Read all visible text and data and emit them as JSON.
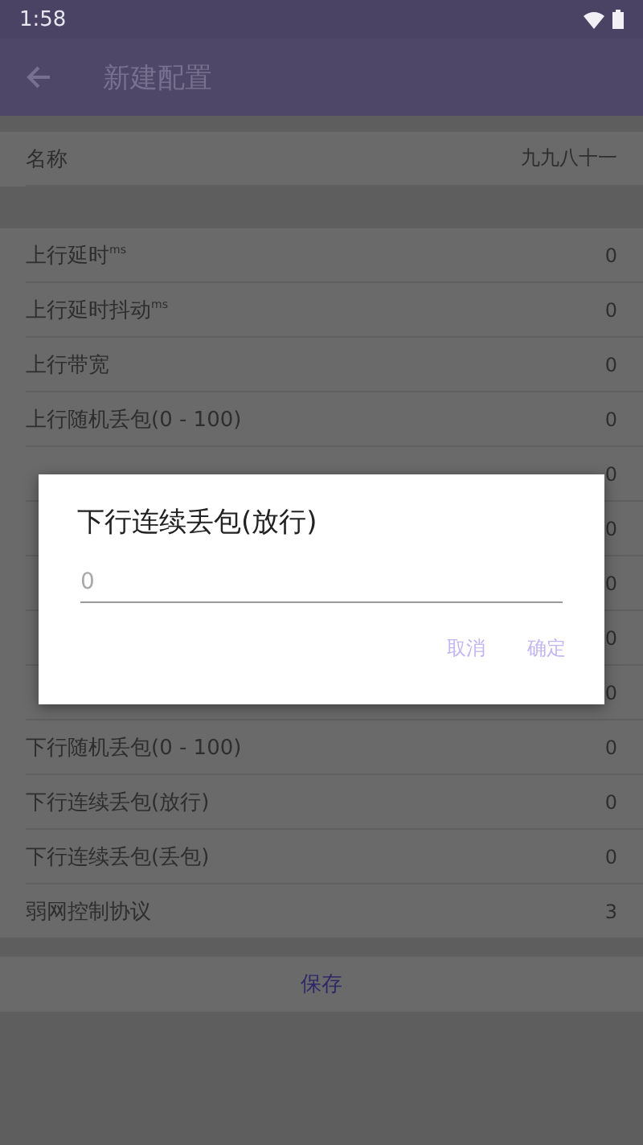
{
  "status_bar": {
    "time": "1:58"
  },
  "toolbar": {
    "title": "新建配置"
  },
  "name_row": {
    "label": "名称",
    "value": "九九八十一"
  },
  "rows": [
    {
      "label": "上行延时$^{ms}$",
      "value": "0"
    },
    {
      "label": "上行延时抖动$^{ms}$",
      "value": "0"
    },
    {
      "label": "上行带宽",
      "value": "0"
    },
    {
      "label": "上行随机丢包(0 - 100)",
      "value": "0"
    },
    {
      "value": "0"
    },
    {
      "value": "0"
    },
    {
      "value": "0"
    },
    {
      "value": "0"
    },
    {
      "value": "0"
    },
    {
      "label": "下行随机丢包(0 - 100)",
      "value": "0"
    },
    {
      "label": "下行连续丢包(放行)",
      "value": "0"
    },
    {
      "label": "下行连续丢包(丢包)",
      "value": "0"
    },
    {
      "label": "弱网控制协议",
      "value": "3"
    }
  ],
  "save_button": "保存",
  "dialog": {
    "title": "下行连续丢包(放行)",
    "placeholder": "0",
    "buttons": [
      "取消",
      "确定"
    ]
  }
}
